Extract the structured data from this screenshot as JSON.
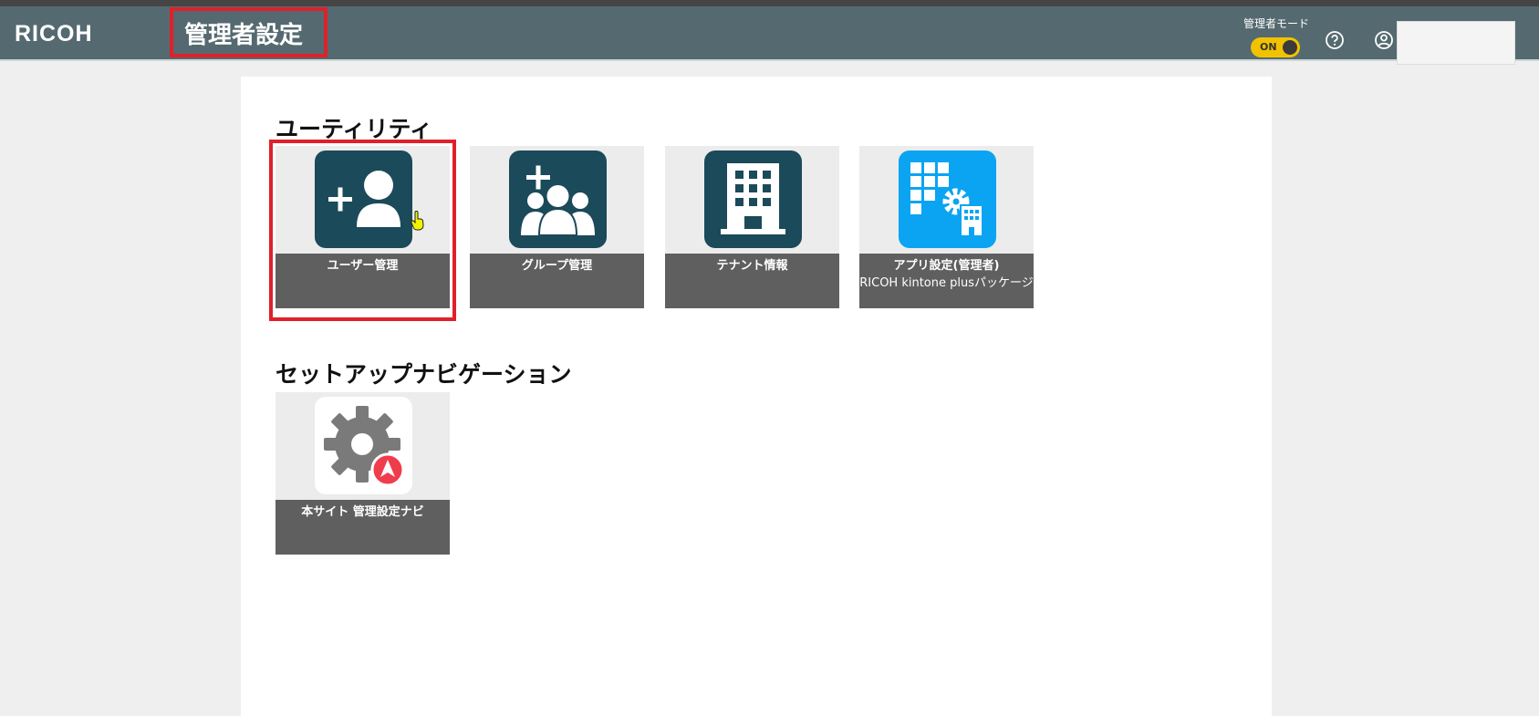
{
  "header": {
    "logo": "RICOH",
    "title": "管理者設定",
    "admin_mode_label": "管理者モード",
    "admin_mode_state": "ON",
    "help_icon": "help-icon",
    "user_icon": "user-icon"
  },
  "sections": {
    "utility": {
      "title": "ユーティリティ",
      "tiles": [
        {
          "label": "ユーザー管理",
          "icon": "add-user-icon"
        },
        {
          "label": "グループ管理",
          "icon": "add-group-icon"
        },
        {
          "label": "テナント情報",
          "icon": "building-icon"
        },
        {
          "label": "アプリ設定(管理者)",
          "sublabel": "RICOH kintone plusパッケージ",
          "icon": "app-settings-icon"
        }
      ]
    },
    "setup": {
      "title": "セットアップナビゲーション",
      "tiles": [
        {
          "label": "本サイト 管理設定ナビ",
          "icon": "gear-navigation-icon"
        }
      ]
    }
  },
  "colors": {
    "header_bg": "#546a70",
    "tile_icon_dark": "#1b4a5a",
    "tile_icon_blue": "#0aa4f2",
    "toggle": "#f2c200",
    "highlight": "#e0202a",
    "nav_badge": "#ef3d4d"
  }
}
